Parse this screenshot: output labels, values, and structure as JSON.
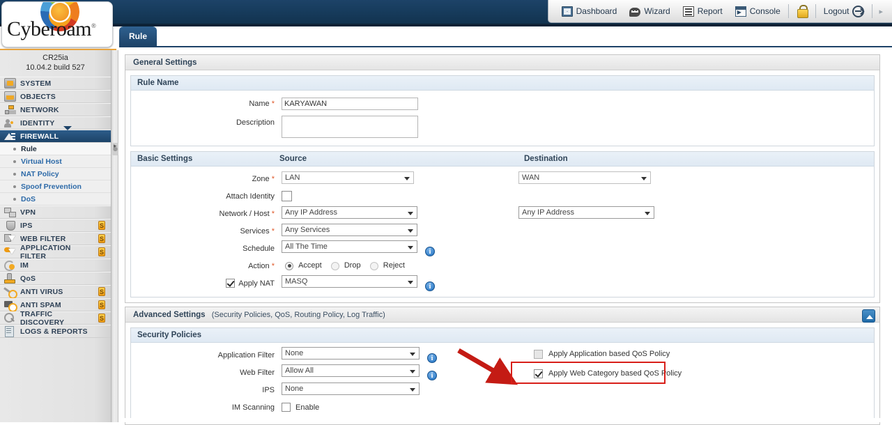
{
  "topnav": {
    "items": [
      {
        "label": "Dashboard",
        "icon": "dashboard-icon"
      },
      {
        "label": "Wizard",
        "icon": "wizard-icon"
      },
      {
        "label": "Report",
        "icon": "report-icon"
      },
      {
        "label": "Console",
        "icon": "console-icon"
      }
    ],
    "lock_icon": "lock-icon",
    "logout_label": "Logout",
    "logout_icon": "logout-arrow-icon",
    "more_arrow": "▸"
  },
  "brand": {
    "name": "Cyberoam",
    "registered": "®",
    "model": "CR25ia",
    "firmware": "10.04.2 build 527"
  },
  "sidebar": {
    "items": [
      {
        "label": "SYSTEM",
        "icon": "system-icon",
        "badge": ""
      },
      {
        "label": "OBJECTS",
        "icon": "objects-icon",
        "badge": ""
      },
      {
        "label": "NETWORK",
        "icon": "network-icon",
        "badge": ""
      },
      {
        "label": "IDENTITY",
        "icon": "identity-icon",
        "badge": ""
      },
      {
        "label": "FIREWALL",
        "icon": "firewall-icon",
        "badge": "",
        "active": true
      },
      {
        "label": "VPN",
        "icon": "vpn-icon",
        "badge": ""
      },
      {
        "label": "IPS",
        "icon": "ips-icon",
        "badge": "S"
      },
      {
        "label": "WEB FILTER",
        "icon": "web-filter-icon",
        "badge": "S"
      },
      {
        "label": "APPLICATION FILTER",
        "icon": "app-filter-icon",
        "badge": "S"
      },
      {
        "label": "IM",
        "icon": "im-icon",
        "badge": ""
      },
      {
        "label": "QoS",
        "icon": "qos-icon",
        "badge": ""
      },
      {
        "label": "ANTI VIRUS",
        "icon": "anti-virus-icon",
        "badge": "S"
      },
      {
        "label": "ANTI SPAM",
        "icon": "anti-spam-icon",
        "badge": "S"
      },
      {
        "label": "TRAFFIC DISCOVERY",
        "icon": "traffic-discovery-icon",
        "badge": "S"
      },
      {
        "label": "LOGS & REPORTS",
        "icon": "logs-reports-icon",
        "badge": ""
      }
    ],
    "submenu": [
      {
        "label": "Rule",
        "current": true
      },
      {
        "label": "Virtual Host",
        "current": false
      },
      {
        "label": "NAT Policy",
        "current": false
      },
      {
        "label": "Spoof Prevention",
        "current": false
      },
      {
        "label": "DoS",
        "current": false
      }
    ]
  },
  "tab": {
    "label": "Rule"
  },
  "general": {
    "title": "General Settings",
    "rule_name_group": "Rule Name",
    "name_label": "Name",
    "name_value": "KARYAWAN",
    "description_label": "Description",
    "description_value": ""
  },
  "basic": {
    "title": "Basic Settings",
    "col_source": "Source",
    "col_destination": "Destination",
    "zone_label": "Zone",
    "zone_source": "LAN",
    "zone_destination": "WAN",
    "attach_identity_label": "Attach Identity",
    "attach_identity_checked": false,
    "network_host_label": "Network / Host",
    "network_host_source": "Any IP Address",
    "network_host_destination": "Any IP Address",
    "services_label": "Services",
    "services_value": "Any Services",
    "schedule_label": "Schedule",
    "schedule_value": "All The Time",
    "action_label": "Action",
    "action_options": [
      "Accept",
      "Drop",
      "Reject"
    ],
    "action_selected": "Accept",
    "apply_nat_label": "Apply NAT",
    "apply_nat_checked": true,
    "apply_nat_value": "MASQ"
  },
  "advanced": {
    "title": "Advanced Settings",
    "subtitle": "(Security Policies, QoS, Routing Policy, Log Traffic)",
    "security_policies_title": "Security Policies",
    "application_filter_label": "Application Filter",
    "application_filter_value": "None",
    "web_filter_label": "Web Filter",
    "web_filter_value": "Allow  All",
    "ips_label": "IPS",
    "ips_value": "None",
    "im_scanning_label": "IM Scanning",
    "im_scanning_enable_label": "Enable",
    "im_scanning_checked": false,
    "qos_app_label": "Apply Application based QoS Policy",
    "qos_app_checked": false,
    "qos_web_label": "Apply Web Category based QoS Policy",
    "qos_web_checked": true
  },
  "annotation": {
    "highlight_color": "#d81f19",
    "arrow_color": "#c41b14"
  },
  "required_marker": "*",
  "info_glyph": "i"
}
